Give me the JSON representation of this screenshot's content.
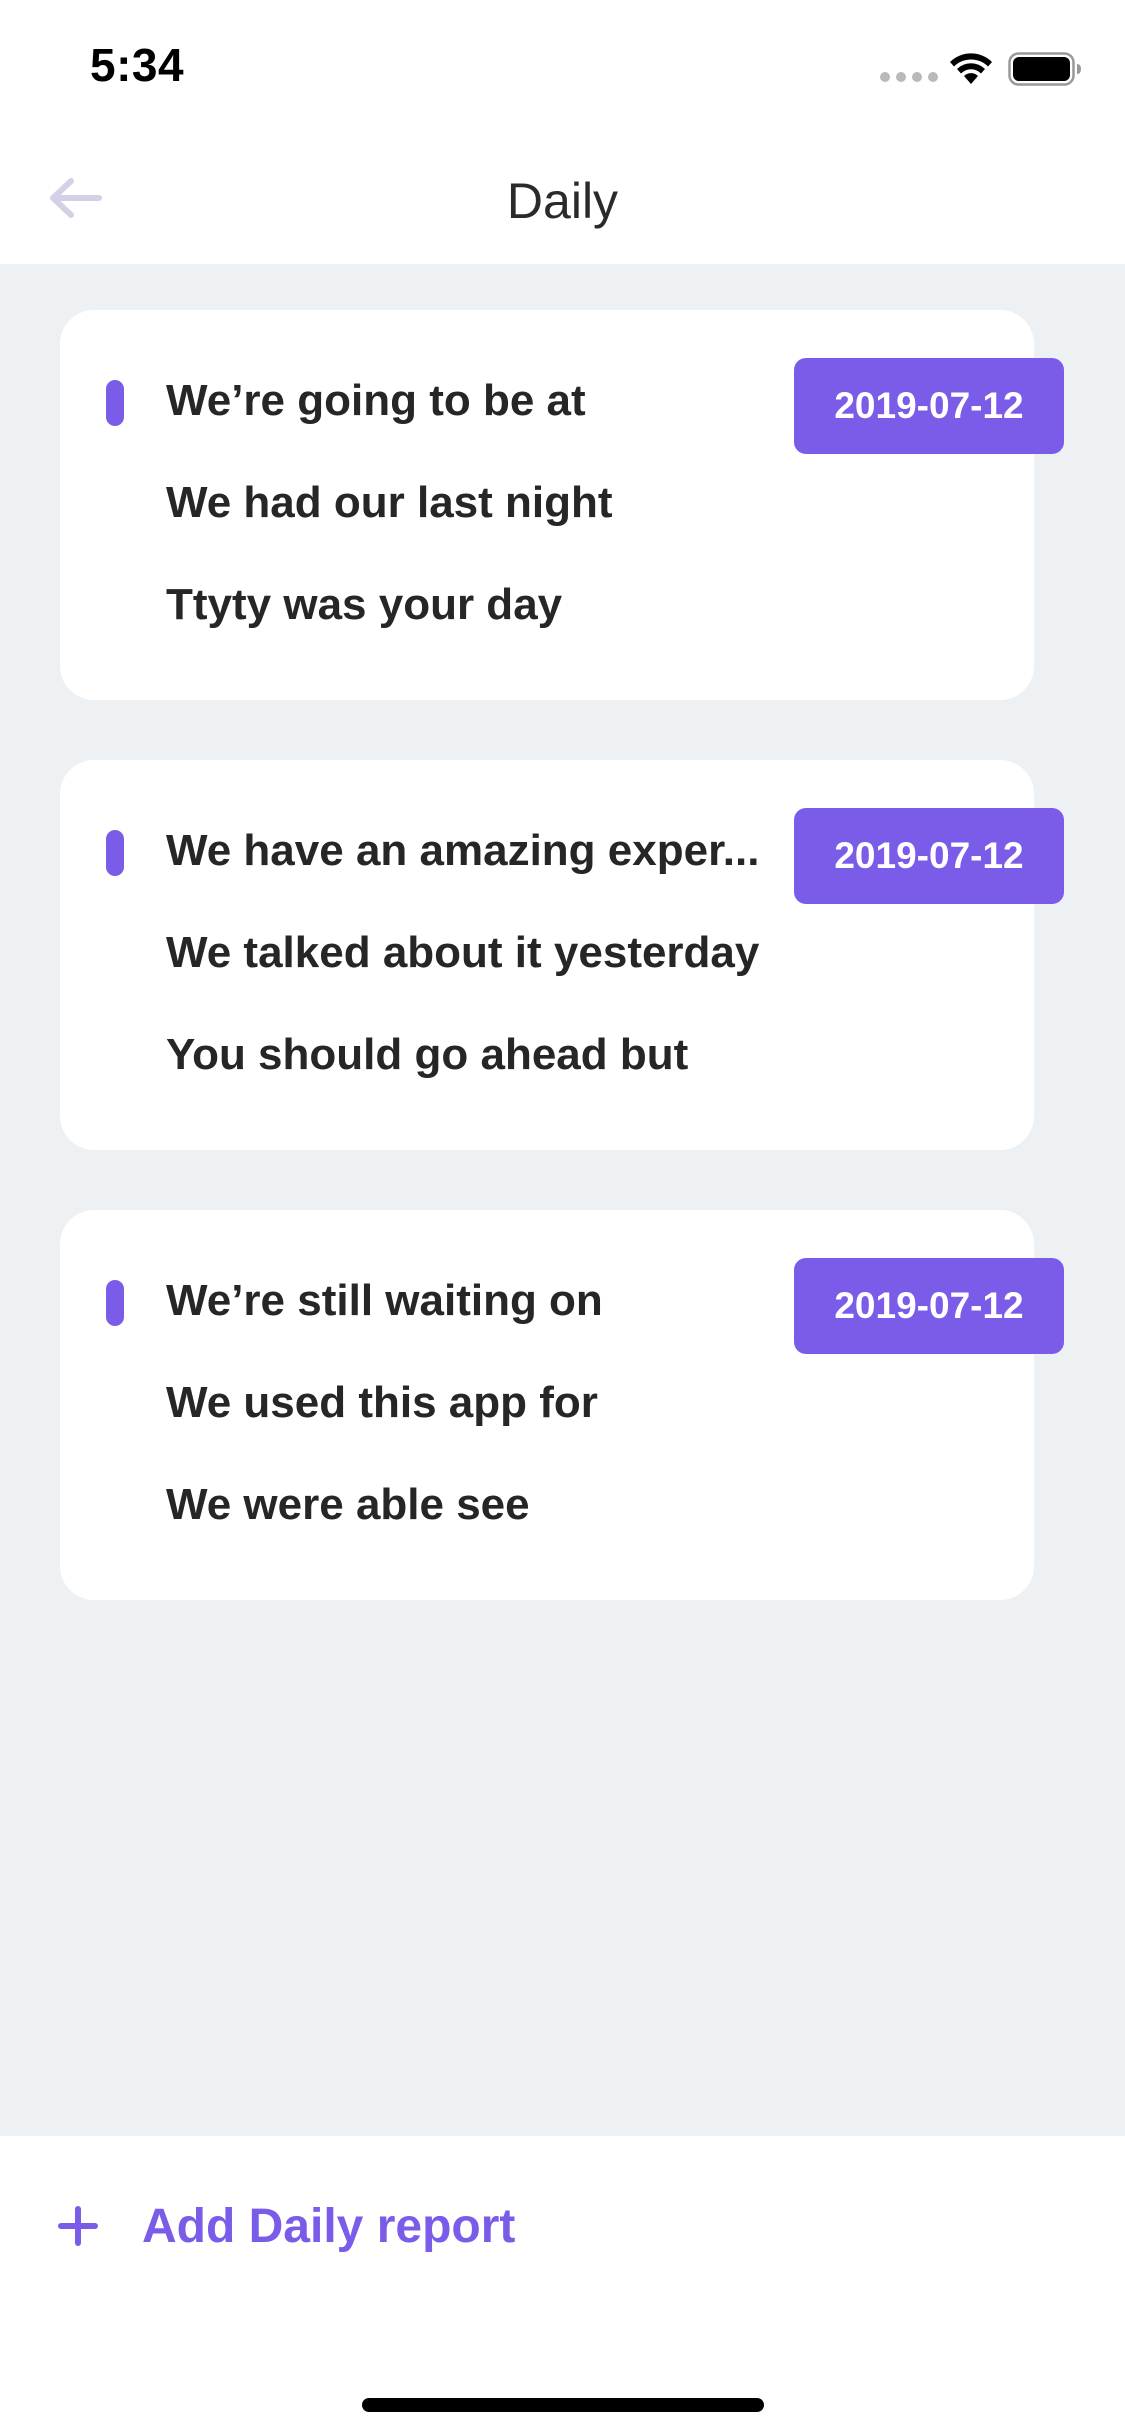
{
  "status_bar": {
    "time": "5:34"
  },
  "nav": {
    "title": "Daily",
    "back_icon": "arrow-left-icon"
  },
  "colors": {
    "accent": "#7b5ce8",
    "background": "#eef1f4",
    "card": "#ffffff",
    "text": "#262626"
  },
  "reports": [
    {
      "lines": [
        "We’re going to be at",
        "We had our last night",
        "Ttyty was your day"
      ],
      "date": "2019-07-12"
    },
    {
      "lines": [
        "We have an amazing exper...",
        "We talked about it yesterday",
        "You should go ahead but"
      ],
      "date": "2019-07-12"
    },
    {
      "lines": [
        "We’re still waiting on",
        "We used this app for",
        "We were able see"
      ],
      "date": "2019-07-12"
    }
  ],
  "footer": {
    "add_label": "Add Daily report",
    "add_icon": "plus-icon"
  }
}
